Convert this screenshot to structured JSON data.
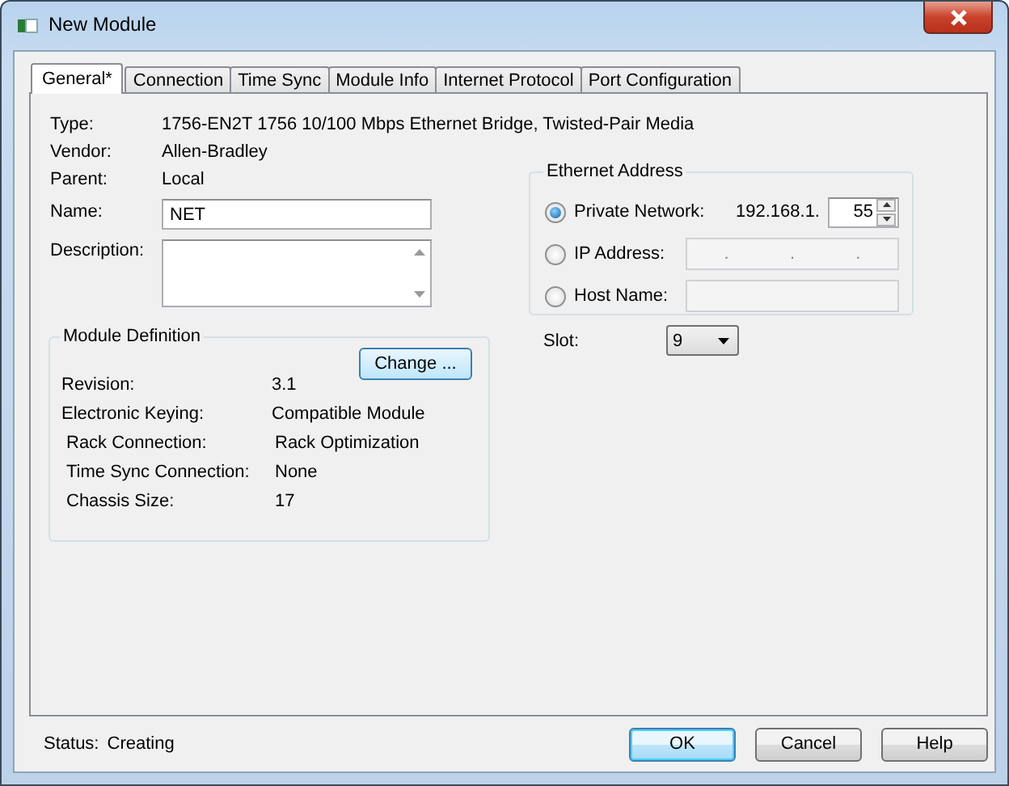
{
  "window": {
    "title": "New Module"
  },
  "tabs": [
    {
      "label": "General*",
      "selected": true
    },
    {
      "label": "Connection",
      "selected": false
    },
    {
      "label": "Time Sync",
      "selected": false
    },
    {
      "label": "Module Info",
      "selected": false
    },
    {
      "label": "Internet Protocol",
      "selected": false
    },
    {
      "label": "Port Configuration",
      "selected": false
    }
  ],
  "info": [
    {
      "label": "Type:",
      "value": "1756-EN2T 1756 10/100 Mbps Ethernet Bridge, Twisted-Pair Media"
    },
    {
      "label": "Vendor:",
      "value": "Allen-Bradley"
    },
    {
      "label": "Parent:",
      "value": "Local"
    }
  ],
  "name_field": {
    "label": "Name:",
    "value": "NET"
  },
  "description_field": {
    "label": "Description:"
  },
  "module_definition": {
    "title": "Module Definition",
    "button": "Change ...",
    "rows": [
      {
        "label": "Revision:",
        "value": "3.1"
      },
      {
        "label": "Electronic Keying:",
        "value": "Compatible Module"
      },
      {
        "label": "Rack Connection:",
        "value": "Rack Optimization"
      },
      {
        "label": "Time Sync Connection:",
        "value": "None"
      },
      {
        "label": "Chassis Size:",
        "value": "17"
      }
    ]
  },
  "ethernet_address": {
    "title": "Ethernet Address",
    "options": [
      {
        "kind": "private",
        "label": "Private Network:",
        "selected": true,
        "prefix": "192.168.1.",
        "value": "55"
      },
      {
        "kind": "ip",
        "label": "IP Address:",
        "selected": false,
        "separators": [
          ".",
          ".",
          "."
        ]
      },
      {
        "kind": "host",
        "label": "Host Name:",
        "selected": false
      }
    ]
  },
  "slot": {
    "label": "Slot:",
    "value": "9"
  },
  "status": {
    "label": "Status:",
    "value": "Creating"
  },
  "buttons": [
    {
      "label": "OK",
      "default": true
    },
    {
      "label": "Cancel",
      "default": false
    },
    {
      "label": "Help",
      "default": false
    }
  ]
}
